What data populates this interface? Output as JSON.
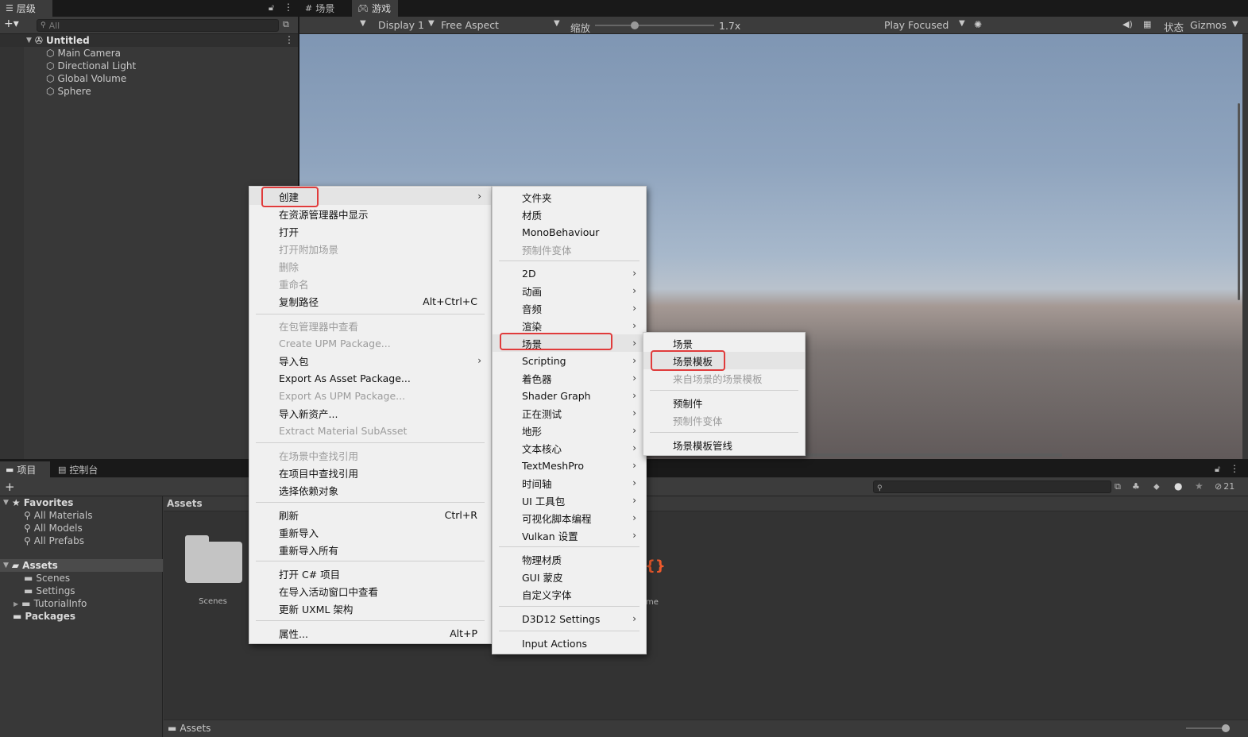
{
  "hierarchy": {
    "tab": "层级",
    "search_placeholder": "All",
    "scene": "Untitled",
    "items": [
      "Main Camera",
      "Directional Light",
      "Global Volume",
      "Sphere"
    ]
  },
  "game_tabs": {
    "scene": "场景",
    "game": "游戏"
  },
  "game_toolbar": {
    "display": "Display 1",
    "aspect": "Free Aspect",
    "scale_label": "缩放",
    "scale_value": "1.7x",
    "scale_fraction": 0.33,
    "play_mode": "Play Focused",
    "stats": "状态",
    "gizmos": "Gizmos"
  },
  "project": {
    "tab_project": "项目",
    "tab_console": "控制台",
    "favorites": "Favorites",
    "fav_items": [
      "All Materials",
      "All Models",
      "All Prefabs"
    ],
    "assets": "Assets",
    "asset_items": [
      "Scenes",
      "Settings",
      "TutorialInfo"
    ],
    "packages": "Packages",
    "breadcrumb": "Assets",
    "folder_label": "Scenes",
    "partial_label": "me",
    "footer_path": "Assets",
    "hidden_count": "21"
  },
  "menu1": {
    "items": [
      {
        "label": "创建",
        "arrow": true
      },
      {
        "label": "在资源管理器中显示"
      },
      {
        "label": "打开"
      },
      {
        "label": "打开附加场景",
        "disabled": true
      },
      {
        "label": "删除",
        "disabled": true
      },
      {
        "label": "重命名",
        "disabled": true
      },
      {
        "label": "复制路径",
        "shortcut": "Alt+Ctrl+C"
      },
      {
        "label": "在包管理器中查看",
        "disabled": true
      },
      {
        "label": "Create UPM Package...",
        "disabled": true
      },
      {
        "label": "导入包",
        "arrow": true
      },
      {
        "label": "Export As Asset Package..."
      },
      {
        "label": "Export As UPM Package...",
        "disabled": true
      },
      {
        "label": "导入新资产..."
      },
      {
        "label": "Extract Material SubAsset",
        "disabled": true
      },
      {
        "label": "在场景中查找引用",
        "disabled": true
      },
      {
        "label": "在项目中查找引用"
      },
      {
        "label": "选择依赖对象"
      },
      {
        "label": "刷新",
        "shortcut": "Ctrl+R"
      },
      {
        "label": "重新导入"
      },
      {
        "label": "重新导入所有"
      },
      {
        "label": "打开 C# 项目"
      },
      {
        "label": "在导入活动窗口中查看"
      },
      {
        "label": "更新 UXML 架构"
      },
      {
        "label": "属性...",
        "shortcut": "Alt+P"
      }
    ]
  },
  "menu2": {
    "items": [
      {
        "label": "文件夹"
      },
      {
        "label": "材质"
      },
      {
        "label": "MonoBehaviour"
      },
      {
        "label": "预制件变体",
        "disabled": true
      },
      {
        "label": "2D",
        "arrow": true
      },
      {
        "label": "动画",
        "arrow": true
      },
      {
        "label": "音频",
        "arrow": true
      },
      {
        "label": "渲染",
        "arrow": true
      },
      {
        "label": "场景",
        "arrow": true
      },
      {
        "label": "Scripting",
        "arrow": true
      },
      {
        "label": "着色器",
        "arrow": true
      },
      {
        "label": "Shader Graph",
        "arrow": true
      },
      {
        "label": "正在测试",
        "arrow": true
      },
      {
        "label": "地形",
        "arrow": true
      },
      {
        "label": "文本核心",
        "arrow": true
      },
      {
        "label": "TextMeshPro",
        "arrow": true
      },
      {
        "label": "时间轴",
        "arrow": true
      },
      {
        "label": "UI 工具包",
        "arrow": true
      },
      {
        "label": "可视化脚本编程",
        "arrow": true
      },
      {
        "label": "Vulkan 设置",
        "arrow": true
      },
      {
        "label": "物理材质"
      },
      {
        "label": "GUI 蒙皮"
      },
      {
        "label": "自定义字体"
      },
      {
        "label": "D3D12 Settings",
        "arrow": true
      },
      {
        "label": "Input Actions"
      }
    ]
  },
  "menu3": {
    "items": [
      {
        "label": "场景"
      },
      {
        "label": "场景模板"
      },
      {
        "label": "来自场景的场景模板",
        "disabled": true
      },
      {
        "label": "预制件"
      },
      {
        "label": "预制件变体",
        "disabled": true
      },
      {
        "label": "场景模板管线"
      }
    ]
  },
  "colors": {
    "highlight": "#e03b3b",
    "menu_bg": "#f0f0f0",
    "panel_bg": "#383838"
  }
}
